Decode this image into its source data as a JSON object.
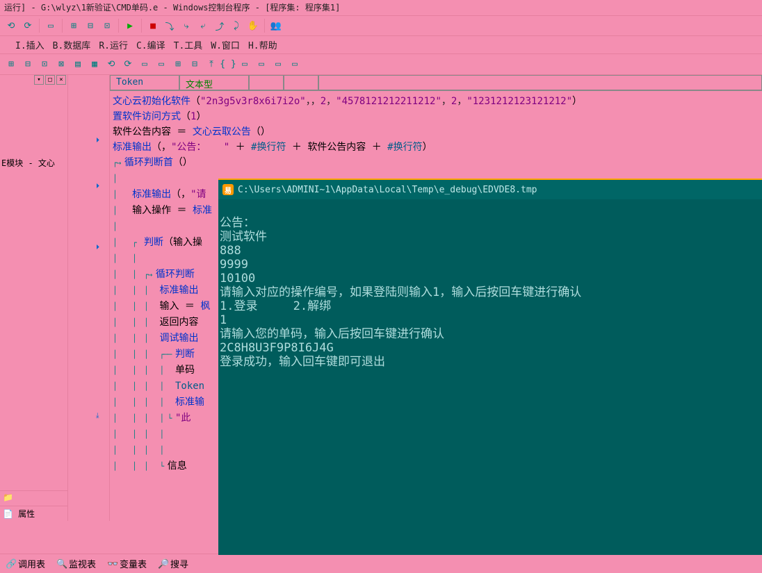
{
  "title": "运行] - G:\\wlyz\\1新验证\\CMD单码.e - Windows控制台程序 - [程序集: 程序集1]",
  "menu": {
    "items": [
      "I.插入",
      "B.数据库",
      "R.运行",
      "C.编译",
      "T.工具",
      "W.窗口",
      "H.帮助"
    ]
  },
  "sidepanel": {
    "title": "E模块 - 文心",
    "prop_tab": "属性"
  },
  "header_cells": {
    "token": "Token",
    "type": "文本型"
  },
  "code": {
    "l1a": "文心云初始化软件",
    "l1b": "（",
    "l1c": "\"2n3g5v3r8x6i7i2o\"",
    "l1d": "，，",
    "l1e": "2",
    "l1f": "，",
    "l1g": "\"4578121212211212\"",
    "l1h": "，",
    "l1i": "2",
    "l1j": "，",
    "l1k": "\"1231212123121212\"",
    "l1l": "）",
    "l2a": "置软件访问方式",
    "l2b": "（",
    "l2c": "1",
    "l2d": "）",
    "l3a": "软件公告内容",
    "l3b": " ＝ ",
    "l3c": "文心云取公告",
    "l3d": "（）",
    "l4a": "标准输出",
    "l4b": "（，",
    "l4c": "\"公告：   \"",
    "l4d": " ＋ ",
    "l4e": "#换行符",
    "l4f": " ＋ ",
    "l4g": "软件公告内容",
    "l4h": " ＋ ",
    "l4i": "#换行符",
    "l4j": "）",
    "l5a": "循环判断首",
    "l5b": "（）",
    "l6a": "标准输出",
    "l6b": "（，",
    "l6c": "\"请",
    "l7a": "输入操作",
    "l7b": " ＝ ",
    "l7c": "标准",
    "l8a": "判断",
    "l8b": "（输入操",
    "l9a": "循环判断",
    "l10a": "标准输出",
    "l11a": "输入",
    "l11b": " ＝ ",
    "l11c": "枫",
    "l12a": "返回内容",
    "l13a": "调试输出",
    "l14a": "判断",
    "l15a": "单码",
    "l16a": "Token",
    "l17a": "标准输",
    "l18a": "\"此",
    "l19a": "信息"
  },
  "console": {
    "path": "C:\\Users\\ADMINI~1\\AppData\\Local\\Temp\\e_debug\\EDVDE8.tmp",
    "lines": [
      "公告：",
      "测试软件",
      "888",
      "9999",
      "10100",
      "请输入对应的操作编号，如果登陆则输入1，输入后按回车键进行确认",
      "1.登录     2.解绑",
      "1",
      "请输入您的单码，输入后按回车键进行确认",
      "2C8H8U3F9P8I6J4G",
      "登录成功，输入回车键即可退出"
    ]
  },
  "bottom": {
    "tab1": "调用表",
    "tab2": "监视表",
    "tab3": "变量表",
    "tab4": "搜寻"
  }
}
